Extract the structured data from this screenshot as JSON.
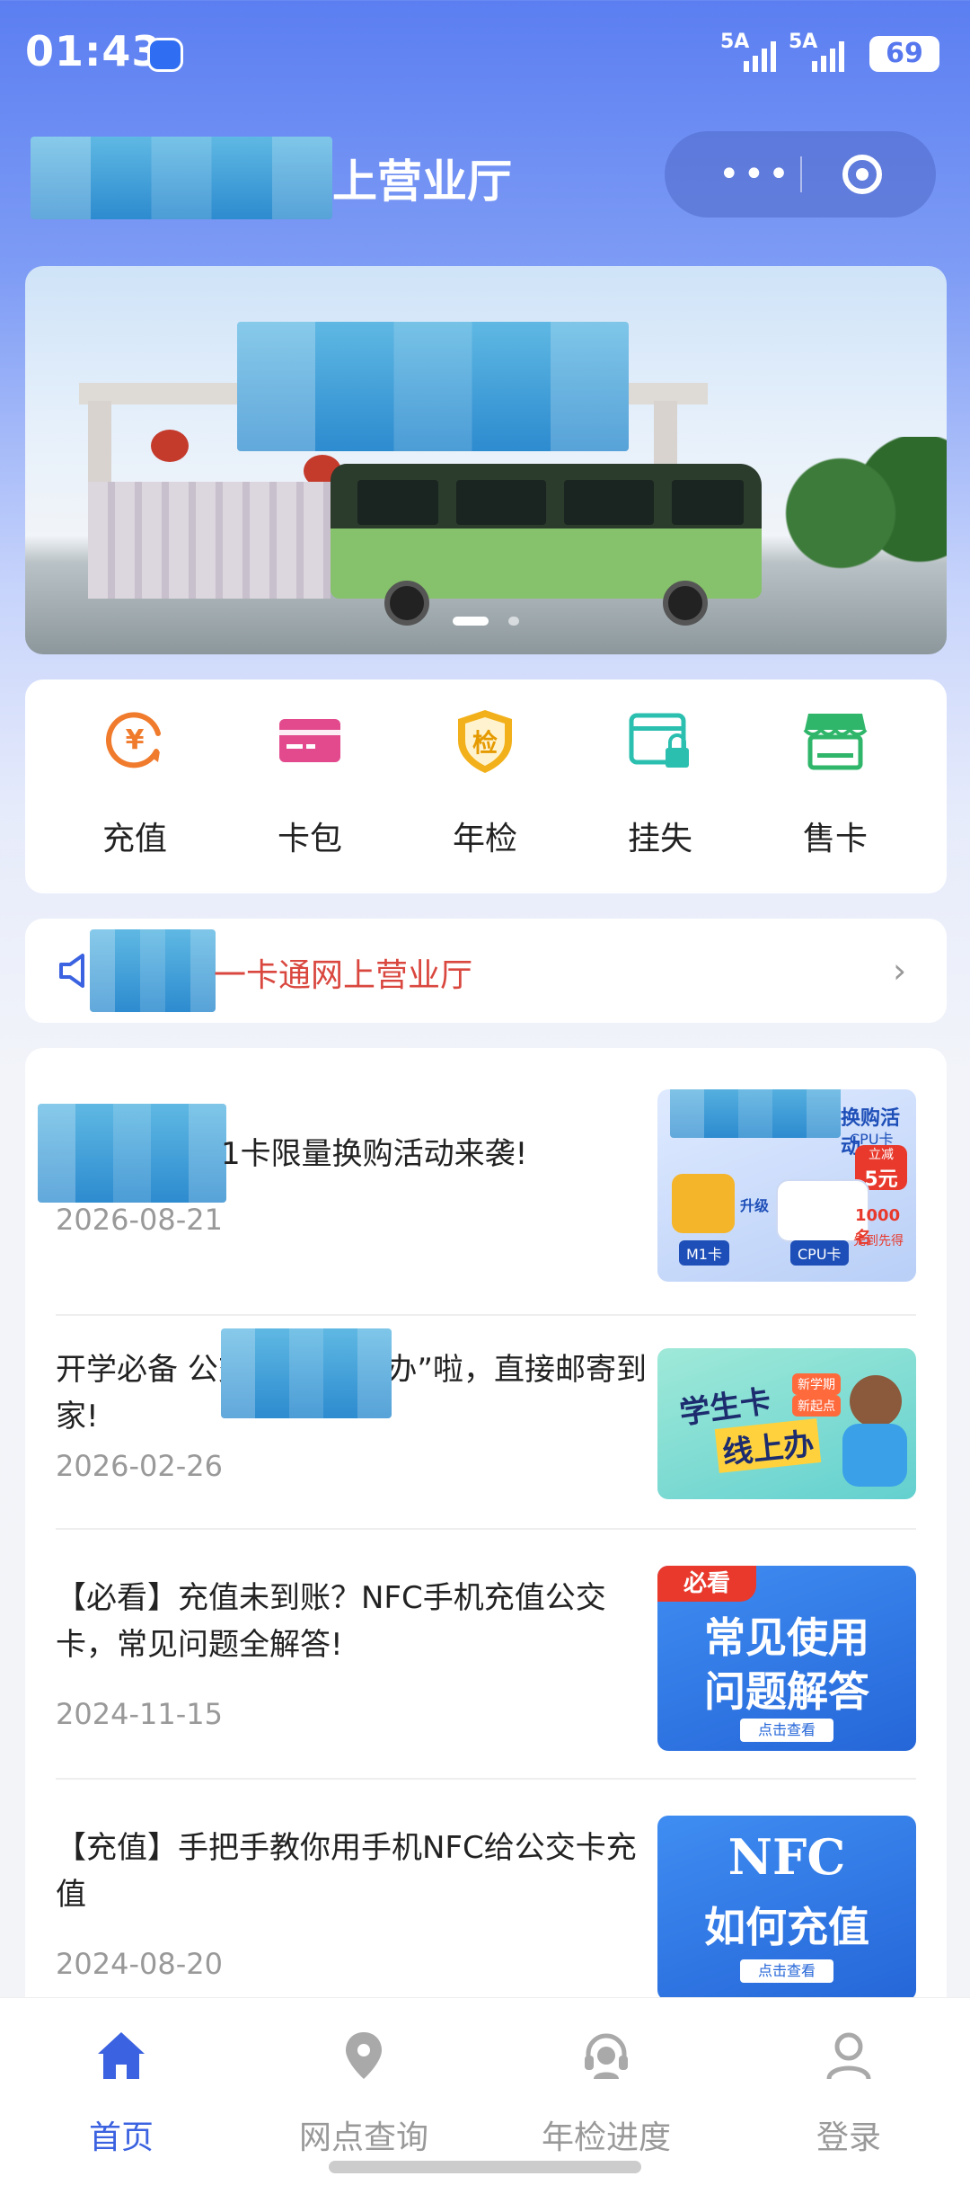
{
  "status_bar": {
    "time": "01:43",
    "signal1": "5A",
    "signal2": "5A",
    "battery": "69"
  },
  "header": {
    "title": "上营业厅",
    "more_icon": "more-dots-icon",
    "close_icon": "target-circle-icon"
  },
  "banner": {
    "active_index": 0,
    "count": 2
  },
  "quick_actions": [
    {
      "label": "充值",
      "icon": "yuan-refresh-icon",
      "color": "#f07b2d"
    },
    {
      "label": "卡包",
      "icon": "card-icon",
      "color": "#e24a8d"
    },
    {
      "label": "年检",
      "icon": "shield-check-icon",
      "color": "#f2b11b"
    },
    {
      "label": "挂失",
      "icon": "card-lock-icon",
      "color": "#2bbfb0"
    },
    {
      "label": "售卡",
      "icon": "store-icon",
      "color": "#2fb66a"
    }
  ],
  "notice": {
    "text": "一卡通网上营业厅",
    "icon": "speaker-icon"
  },
  "news": [
    {
      "title": "1卡限量换购活动来袭!",
      "date": "2026-08-21",
      "thumb": {
        "texts": [
          "换购活动",
          "CPU卡",
          "立减",
          "5元",
          "M1卡",
          "升级",
          "CPU卡",
          "1000名",
          "先到先得"
        ]
      }
    },
    {
      "title": "开学必备        公交卡可“线上办”啦，直接邮寄到家!",
      "date": "2026-02-26",
      "thumb": {
        "texts": [
          "学生卡",
          "线上办",
          "新学期",
          "新起点"
        ]
      }
    },
    {
      "title": "【必看】充值未到账？NFC手机充值公交卡，常见问题全解答!",
      "date": "2024-11-15",
      "thumb": {
        "texts": [
          "必看",
          "常见使用",
          "问题解答",
          "点击查看"
        ]
      }
    },
    {
      "title": "【充值】手把手教你用手机NFC给公交卡充值",
      "date": "2024-08-20",
      "thumb": {
        "texts": [
          "NFC",
          "如何充值",
          "点击查看"
        ]
      }
    }
  ],
  "tabs": [
    {
      "label": "首页",
      "icon": "home-icon",
      "active": true
    },
    {
      "label": "网点查询",
      "icon": "location-pin-icon",
      "active": false
    },
    {
      "label": "年检进度",
      "icon": "headset-icon",
      "active": false
    },
    {
      "label": "登录",
      "icon": "user-icon",
      "active": false
    }
  ],
  "colors": {
    "accent": "#3b62e0",
    "notice_text": "#d9473f"
  }
}
